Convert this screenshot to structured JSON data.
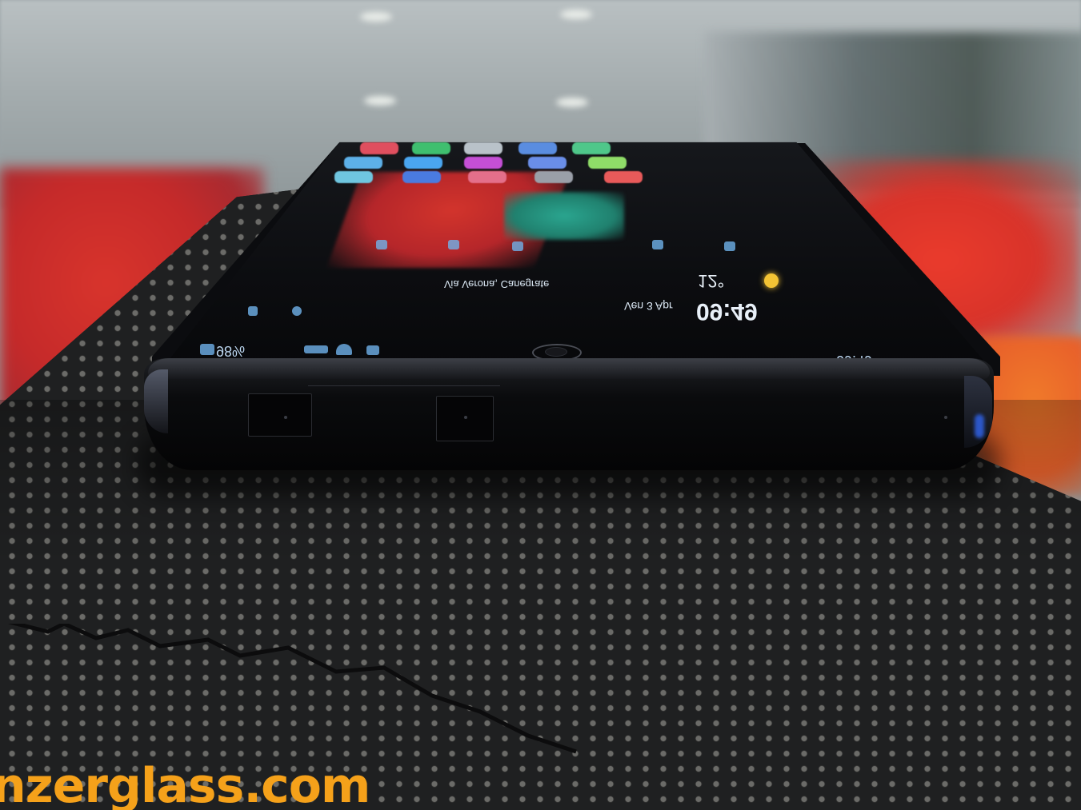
{
  "screen": {
    "lock_clock": "09:49",
    "date": "Ven 3 Apr",
    "location": "Via Verona, Canegrate",
    "temperature": "12°",
    "battery_percent": "98%",
    "status_clock": "09:49"
  },
  "mat": {
    "brand_text": "nzerglass.com"
  },
  "colors": {
    "mat": "#1d1e1f",
    "brand": "#f5a11a",
    "phone": "#0b0c0f",
    "background_red": "#d8342c"
  }
}
